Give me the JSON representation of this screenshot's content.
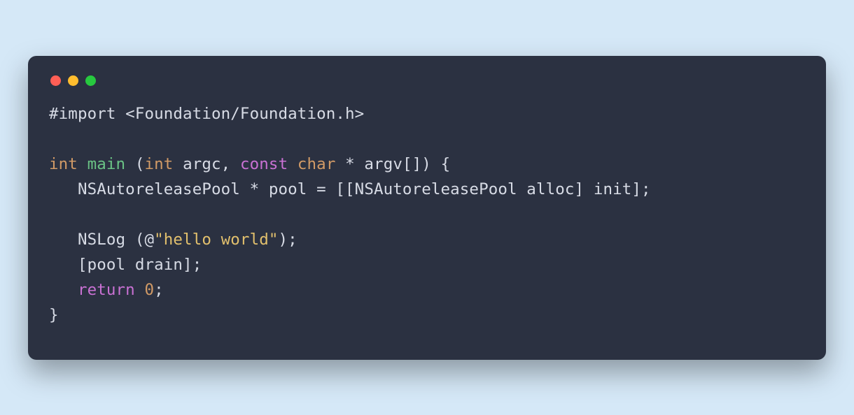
{
  "colors": {
    "background_page": "#d5e8f7",
    "background_window": "#2b3141",
    "text_default": "#d7dbe5",
    "dot_close": "#ff5f56",
    "dot_min": "#ffbd2e",
    "dot_max": "#27c93f",
    "syntax_keyword_type": "#d19a66",
    "syntax_function": "#6ac285",
    "syntax_return": "#c971d3",
    "syntax_number": "#d19a66",
    "syntax_string": "#e2c06d"
  },
  "code": {
    "language": "Objective-C",
    "lines": [
      [
        {
          "class": "tk-pp",
          "text": "#import <Foundation/Foundation.h>"
        }
      ],
      [
        {
          "class": "tk-pp",
          "text": ""
        }
      ],
      [
        {
          "class": "tk-kw",
          "text": "int"
        },
        {
          "class": "tk-pp",
          "text": " "
        },
        {
          "class": "tk-fn",
          "text": "main"
        },
        {
          "class": "tk-pp",
          "text": " ("
        },
        {
          "class": "tk-kw",
          "text": "int"
        },
        {
          "class": "tk-pp",
          "text": " argc, "
        },
        {
          "class": "tk-ret",
          "text": "const"
        },
        {
          "class": "tk-pp",
          "text": " "
        },
        {
          "class": "tk-kw",
          "text": "char"
        },
        {
          "class": "tk-pp",
          "text": " * argv[]) {"
        }
      ],
      [
        {
          "class": "tk-pp",
          "text": "   NSAutoreleasePool * pool = [[NSAutoreleasePool alloc] init];"
        }
      ],
      [
        {
          "class": "tk-pp",
          "text": ""
        }
      ],
      [
        {
          "class": "tk-pp",
          "text": "   NSLog (@"
        },
        {
          "class": "tk-str",
          "text": "\"hello world\""
        },
        {
          "class": "tk-pp",
          "text": ");"
        }
      ],
      [
        {
          "class": "tk-pp",
          "text": "   [pool drain];"
        }
      ],
      [
        {
          "class": "tk-pp",
          "text": "   "
        },
        {
          "class": "tk-ret",
          "text": "return"
        },
        {
          "class": "tk-pp",
          "text": " "
        },
        {
          "class": "tk-num",
          "text": "0"
        },
        {
          "class": "tk-pp",
          "text": ";"
        }
      ],
      [
        {
          "class": "tk-pp",
          "text": "}"
        }
      ]
    ]
  }
}
